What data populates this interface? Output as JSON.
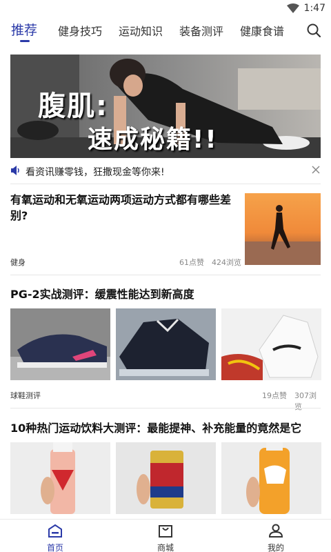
{
  "status_bar": {
    "time": "1:47"
  },
  "tabs": [
    {
      "label": "推荐",
      "active": true
    },
    {
      "label": "健身技巧",
      "active": false
    },
    {
      "label": "运动知识",
      "active": false
    },
    {
      "label": "装备测评",
      "active": false
    },
    {
      "label": "健康食谱",
      "active": false
    }
  ],
  "banner": {
    "line1": "腹肌:",
    "line2": "速成秘籍!!",
    "slide_index": 2,
    "slide_count": 3
  },
  "notice": {
    "text": "看资讯赚零钱，狂撒现金等你来!"
  },
  "articles": [
    {
      "title": "有氧运动和无氧运动两项运动方式都有哪些差别?",
      "category": "健身",
      "likes": "61点赞",
      "views": "424浏览"
    },
    {
      "title": "PG-2实战测评：缓震性能达到新高度",
      "category": "球鞋测评",
      "likes": "19点赞",
      "views": "307浏览"
    },
    {
      "title": "10种热门运动饮料大测评：最能提神、补充能量的竟然是它"
    }
  ],
  "bottom_nav": [
    {
      "label": "首页",
      "icon": "home-icon",
      "active": true
    },
    {
      "label": "商城",
      "icon": "shop-bag-icon",
      "active": false
    },
    {
      "label": "我的",
      "icon": "user-icon",
      "active": false
    }
  ],
  "colors": {
    "accent": "#2b3aa8"
  }
}
